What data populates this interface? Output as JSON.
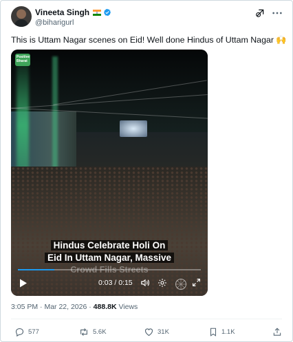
{
  "author": {
    "name": "Vineeta Singh",
    "handle": "@biharigurl"
  },
  "tweet": {
    "text": "This is Uttam Nagar scenes on Eid! Well done Hindus of Uttam Nagar 🙌"
  },
  "video": {
    "caption_lines": [
      "Hindus Celebrate Holi On",
      "Eid In Uttam Nagar, Massive",
      "Crowd Fills Streets"
    ],
    "time": "0:03 / 0:15",
    "progress": 0.2,
    "logo_text": "Positive Bharat"
  },
  "meta": {
    "time": "3:05 PM",
    "sep": "·",
    "date": "Mar 22, 2026",
    "views_count": "488.8K",
    "views_label": "Views"
  },
  "actions": {
    "replies": "577",
    "reposts": "5.6K",
    "likes": "31K",
    "bookmarks": "1.1K"
  },
  "colors": {
    "accent": "#1d9bf0",
    "verified": "#1d9bf0",
    "muted": "#536471"
  },
  "icons": [
    "verified-badge-icon",
    "grok-icon",
    "more-icon",
    "play-icon",
    "volume-icon",
    "settings-icon",
    "fullscreen-icon",
    "reply-icon",
    "repost-icon",
    "like-icon",
    "bookmark-icon",
    "share-icon"
  ]
}
